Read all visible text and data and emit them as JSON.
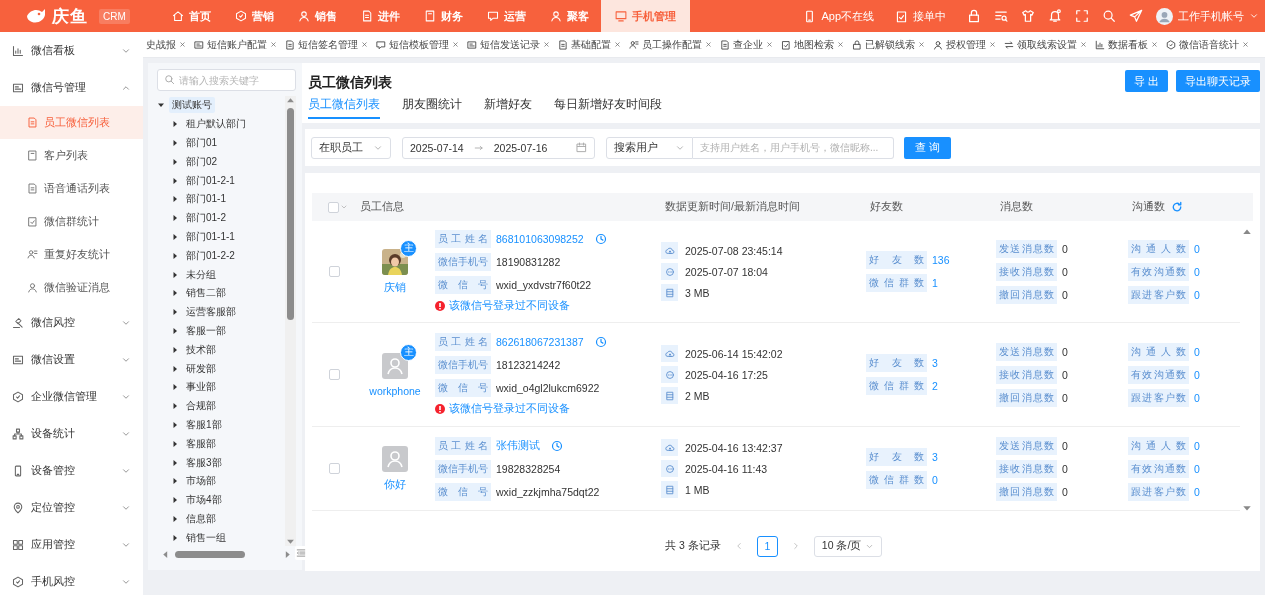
{
  "header": {
    "logo": "庆鱼",
    "badge": "CRM",
    "nav": [
      {
        "label": "首页",
        "selected": false
      },
      {
        "label": "营销",
        "selected": false
      },
      {
        "label": "销售",
        "selected": false
      },
      {
        "label": "进件",
        "selected": false
      },
      {
        "label": "财务",
        "selected": false
      },
      {
        "label": "运营",
        "selected": false
      },
      {
        "label": "聚客",
        "selected": false
      },
      {
        "label": "手机管理",
        "selected": true
      }
    ],
    "status": [
      "App不在线",
      "接单中"
    ],
    "user": "工作手机帐号"
  },
  "open_tabs": [
    {
      "label": "史战报",
      "selected": false
    },
    {
      "label": "短信账户配置",
      "selected": false
    },
    {
      "label": "短信签名管理",
      "selected": false
    },
    {
      "label": "短信模板管理",
      "selected": false
    },
    {
      "label": "短信发送记录",
      "selected": false
    },
    {
      "label": "基础配置",
      "selected": false
    },
    {
      "label": "员工操作配置",
      "selected": false
    },
    {
      "label": "查企业",
      "selected": false
    },
    {
      "label": "地图检索",
      "selected": false
    },
    {
      "label": "已解锁线索",
      "selected": false
    },
    {
      "label": "授权管理",
      "selected": false
    },
    {
      "label": "领取线索设置",
      "selected": false
    },
    {
      "label": "数据看板",
      "selected": false
    },
    {
      "label": "微信语音统计",
      "selected": false
    }
  ],
  "sidebar": {
    "items": [
      {
        "label": "微信看板",
        "expanded": false
      },
      {
        "label": "微信号管理",
        "expanded": true,
        "children": [
          {
            "label": "员工微信列表",
            "selected": true
          },
          {
            "label": "客户列表",
            "selected": false
          },
          {
            "label": "语音通话列表",
            "selected": false
          },
          {
            "label": "微信群统计",
            "selected": false
          },
          {
            "label": "重复好友统计",
            "selected": false
          },
          {
            "label": "微信验证消息",
            "selected": false
          }
        ]
      },
      {
        "label": "微信风控",
        "expanded": false
      },
      {
        "label": "微信设置",
        "expanded": false
      },
      {
        "label": "企业微信管理",
        "expanded": false
      },
      {
        "label": "设备统计",
        "expanded": false
      },
      {
        "label": "设备管控",
        "expanded": false
      },
      {
        "label": "定位管控",
        "expanded": false
      },
      {
        "label": "应用管控",
        "expanded": false
      },
      {
        "label": "手机风控",
        "expanded": false
      }
    ]
  },
  "tree": {
    "search": {
      "placeholder": "请输入搜索关键字"
    },
    "nodes": [
      {
        "label": "测试账号",
        "expanded": true,
        "selected": true,
        "children": [
          {
            "label": "租户默认部门",
            "expanded": false,
            "selected": false
          },
          {
            "label": "部门01",
            "expanded": false,
            "selected": false
          },
          {
            "label": "部门02",
            "expanded": false,
            "selected": false
          },
          {
            "label": "部门01-2-1",
            "expanded": false,
            "selected": false
          },
          {
            "label": "部门01-1",
            "expanded": false,
            "selected": false
          },
          {
            "label": "部门01-2",
            "expanded": false,
            "selected": false
          },
          {
            "label": "部门01-1-1",
            "expanded": false,
            "selected": false
          },
          {
            "label": "部门01-2-2",
            "expanded": false,
            "selected": false
          },
          {
            "label": "未分组",
            "expanded": false,
            "selected": false
          },
          {
            "label": "销售二部",
            "expanded": false,
            "selected": false
          },
          {
            "label": "运营客服部",
            "expanded": false,
            "selected": false
          },
          {
            "label": "客服一部",
            "expanded": false,
            "selected": false
          },
          {
            "label": "技术部",
            "expanded": false,
            "selected": false
          },
          {
            "label": "研发部",
            "expanded": false,
            "selected": false
          },
          {
            "label": "事业部",
            "expanded": false,
            "selected": false
          },
          {
            "label": "合规部",
            "expanded": false,
            "selected": false
          },
          {
            "label": "客服1部",
            "expanded": false,
            "selected": false
          },
          {
            "label": "客服部",
            "expanded": false,
            "selected": false
          },
          {
            "label": "客服3部",
            "expanded": false,
            "selected": false
          },
          {
            "label": "市场部",
            "expanded": false,
            "selected": false
          },
          {
            "label": "市场4部",
            "expanded": false,
            "selected": false
          },
          {
            "label": "信息部",
            "expanded": false,
            "selected": false
          },
          {
            "label": "销售一组",
            "expanded": false,
            "selected": false
          }
        ]
      }
    ]
  },
  "page": {
    "title": "员工微信列表",
    "buttons": [
      "导 出",
      "导出聊天记录"
    ],
    "tabs": [
      {
        "label": "员工微信列表",
        "selected": true
      },
      {
        "label": "朋友圈统计",
        "selected": false
      },
      {
        "label": "新增好友",
        "selected": false
      },
      {
        "label": "每日新增好友时间段",
        "selected": false
      }
    ],
    "filters": {
      "status": "在职员工",
      "date_from": "2025-07-14",
      "date_to": "2025-07-16",
      "search_type": "搜索用户",
      "search": {
        "placeholder": "支持用户姓名，用户手机号，微信昵称..."
      },
      "query": "查 询"
    },
    "table": {
      "all_checked": false,
      "columns": [
        "员工信息",
        "数据更新时间/最新消息时间",
        "好友数",
        "消息数",
        "沟通数"
      ],
      "rows": [
        {
          "checked": false,
          "avatar": {
            "kind": "picture"
          },
          "badge": "主",
          "name": "庆销",
          "fields": [
            {
              "label": "员工姓名",
              "value": "868101063098252",
              "kind": "link"
            },
            {
              "label": "微信手机号",
              "value": "18190831282",
              "kind": "plain"
            },
            {
              "label": "微信号",
              "value": "wxid_yxdvstr7f60t22",
              "kind": "plain"
            }
          ],
          "warning": "该微信号登录过不同设备",
          "updated": "2025-07-08 23:45:14",
          "last_message": "2025-07-07 18:04",
          "size": "3 MB",
          "friends": [
            {
              "label": "好友数",
              "value": "136"
            },
            {
              "label": "微信群数",
              "value": "1"
            }
          ],
          "messages": [
            {
              "label": "发送消息数",
              "value": "0"
            },
            {
              "label": "接收消息数",
              "value": "0"
            },
            {
              "label": "撤回消息数",
              "value": "0"
            }
          ],
          "communication": [
            {
              "label": "沟通人数",
              "value": "0"
            },
            {
              "label": "有效沟通数",
              "value": "0"
            },
            {
              "label": "跟进客户数",
              "value": "0"
            }
          ]
        },
        {
          "checked": false,
          "avatar": {
            "kind": "silhouette"
          },
          "badge": "主",
          "name": "workphone",
          "fields": [
            {
              "label": "员工姓名",
              "value": "862618067231387",
              "kind": "link"
            },
            {
              "label": "微信手机号",
              "value": "18123214242",
              "kind": "plain"
            },
            {
              "label": "微信号",
              "value": "wxid_o4gl2lukcm6922",
              "kind": "plain"
            }
          ],
          "warning": "该微信号登录过不同设备",
          "updated": "2025-06-14 15:42:02",
          "last_message": "2025-04-16 17:25",
          "size": "2 MB",
          "friends": [
            {
              "label": "好友数",
              "value": "3"
            },
            {
              "label": "微信群数",
              "value": "2"
            }
          ],
          "messages": [
            {
              "label": "发送消息数",
              "value": "0"
            },
            {
              "label": "接收消息数",
              "value": "0"
            },
            {
              "label": "撤回消息数",
              "value": "0"
            }
          ],
          "communication": [
            {
              "label": "沟通人数",
              "value": "0"
            },
            {
              "label": "有效沟通数",
              "value": "0"
            },
            {
              "label": "跟进客户数",
              "value": "0"
            }
          ]
        },
        {
          "checked": false,
          "avatar": {
            "kind": "silhouette"
          },
          "name": "你好",
          "fields": [
            {
              "label": "员工姓名",
              "value": "张伟测试",
              "kind": "link"
            },
            {
              "label": "微信手机号",
              "value": "19828328254",
              "kind": "plain"
            },
            {
              "label": "微信号",
              "value": "wxid_zzkjmha75dqt22",
              "kind": "plain"
            }
          ],
          "updated": "2025-04-16 13:42:37",
          "last_message": "2025-04-16 11:43",
          "size": "1 MB",
          "friends": [
            {
              "label": "好友数",
              "value": "3"
            },
            {
              "label": "微信群数",
              "value": "0"
            }
          ],
          "messages": [
            {
              "label": "发送消息数",
              "value": "0"
            },
            {
              "label": "接收消息数",
              "value": "0"
            },
            {
              "label": "撤回消息数",
              "value": "0"
            }
          ],
          "communication": [
            {
              "label": "沟通人数",
              "value": "0"
            },
            {
              "label": "有效沟通数",
              "value": "0"
            },
            {
              "label": "跟进客户数",
              "value": "0"
            }
          ]
        }
      ]
    },
    "pagination": {
      "total": "共 3 条记录",
      "pages": [
        {
          "label": "1",
          "selected": true
        }
      ],
      "page_size": "10 条/页"
    }
  }
}
